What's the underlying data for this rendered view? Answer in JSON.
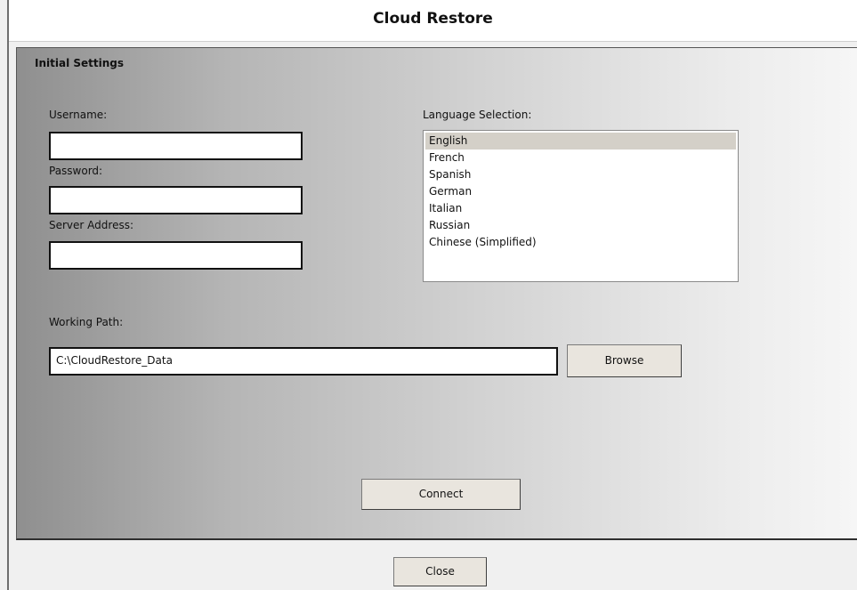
{
  "window": {
    "title": "Cloud Restore"
  },
  "panel": {
    "title": "Initial Settings"
  },
  "fields": {
    "username_label": "Username:",
    "username_value": "",
    "password_label": "Password:",
    "password_value": "",
    "server_label": "Server Address:",
    "server_value": "",
    "working_path_label": "Working Path:",
    "working_path_value": "C:\\CloudRestore_Data"
  },
  "language": {
    "label": "Language Selection:",
    "selected": "English",
    "options": [
      "English",
      "French",
      "Spanish",
      "German",
      "Italian",
      "Russian",
      "Chinese (Simplified)"
    ]
  },
  "buttons": {
    "browse": "Browse",
    "connect": "Connect",
    "close": "Close"
  },
  "colors": {
    "selected_row": "#d4d0c8",
    "button_face": "#e9e5de"
  }
}
